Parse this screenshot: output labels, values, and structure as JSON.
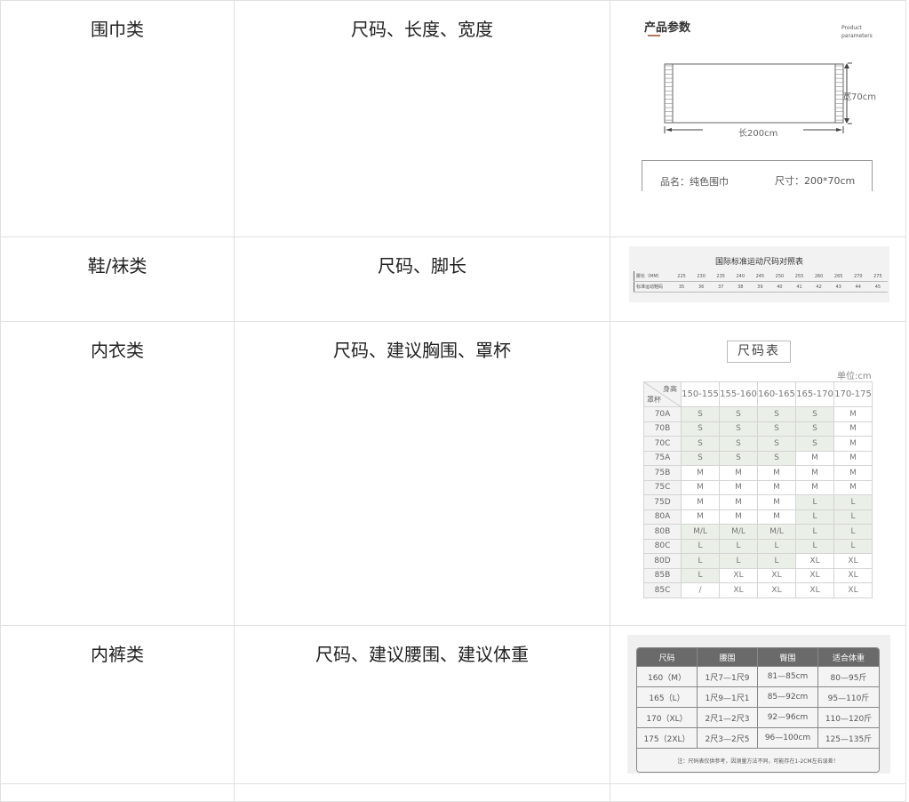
{
  "rows": [
    {
      "category": "围巾类",
      "fields": "尺码、长度、宽度",
      "image": {
        "title": "产品参数",
        "title_en_line1": "Product",
        "title_en_line2": "parameters",
        "width_label": "宽70cm",
        "length_label": "长200cm",
        "name_label": "品名：纯色围巾",
        "size_label": "尺寸：200*70cm"
      }
    },
    {
      "category": "鞋/袜类",
      "fields": "尺码、脚长",
      "image": {
        "title": "国际标准运动尺码对照表",
        "row1_header": "脚长（MM）",
        "row1": [
          "225",
          "230",
          "235",
          "240",
          "245",
          "250",
          "255",
          "260",
          "265",
          "270",
          "275"
        ],
        "row2_header": "标准运动鞋码",
        "row2": [
          "35",
          "36",
          "37",
          "38",
          "39",
          "40",
          "41",
          "42",
          "43",
          "44",
          "45"
        ]
      }
    },
    {
      "category": "内衣类",
      "fields": "尺码、建议胸围、罩杯",
      "image": {
        "title": "尺码表",
        "unit": "单位:cm",
        "corner_top": "身高",
        "corner_bottom": "罩杯",
        "columns": [
          "150-155",
          "155-160",
          "160-165",
          "165-170",
          "170-175"
        ],
        "rows": [
          {
            "cup": "70A",
            "sizes": [
              "S",
              "S",
              "S",
              "S",
              "M"
            ]
          },
          {
            "cup": "70B",
            "sizes": [
              "S",
              "S",
              "S",
              "S",
              "M"
            ]
          },
          {
            "cup": "70C",
            "sizes": [
              "S",
              "S",
              "S",
              "S",
              "M"
            ]
          },
          {
            "cup": "75A",
            "sizes": [
              "S",
              "S",
              "S",
              "M",
              "M"
            ]
          },
          {
            "cup": "75B",
            "sizes": [
              "M",
              "M",
              "M",
              "M",
              "M"
            ]
          },
          {
            "cup": "75C",
            "sizes": [
              "M",
              "M",
              "M",
              "M",
              "M"
            ]
          },
          {
            "cup": "75D",
            "sizes": [
              "M",
              "M",
              "M",
              "L",
              "L"
            ]
          },
          {
            "cup": "80A",
            "sizes": [
              "M",
              "M",
              "M",
              "L",
              "L"
            ]
          },
          {
            "cup": "80B",
            "sizes": [
              "M/L",
              "M/L",
              "M/L",
              "L",
              "L"
            ]
          },
          {
            "cup": "80C",
            "sizes": [
              "L",
              "L",
              "L",
              "L",
              "L"
            ]
          },
          {
            "cup": "80D",
            "sizes": [
              "L",
              "L",
              "L",
              "XL",
              "XL"
            ]
          },
          {
            "cup": "85B",
            "sizes": [
              "L",
              "XL",
              "XL",
              "XL",
              "XL"
            ]
          },
          {
            "cup": "85C",
            "sizes": [
              "/",
              "XL",
              "XL",
              "XL",
              "XL"
            ]
          }
        ],
        "highlight_color": "#eaf0e8"
      }
    },
    {
      "category": "内裤类",
      "fields": "尺码、建议腰围、建议体重",
      "image": {
        "headers": [
          "尺码",
          "腰围",
          "臀围",
          "适合体重"
        ],
        "rows": [
          [
            "160（M）",
            "1尺7—1尺9",
            "81—85cm",
            "80—95斤"
          ],
          [
            "165（L）",
            "1尺9—1尺1",
            "85—92cm",
            "95—110斤"
          ],
          [
            "170（XL）",
            "2尺1—2尺3",
            "92—96cm",
            "110—120斤"
          ],
          [
            "175（2XL）",
            "2尺3—2尺5",
            "96—100cm",
            "125—135斤"
          ]
        ],
        "note": "注：尺码表仅供参考，因测量方法不同，可能存在1-2CM左右误差！",
        "header_color": "#6a6a6a"
      }
    }
  ]
}
